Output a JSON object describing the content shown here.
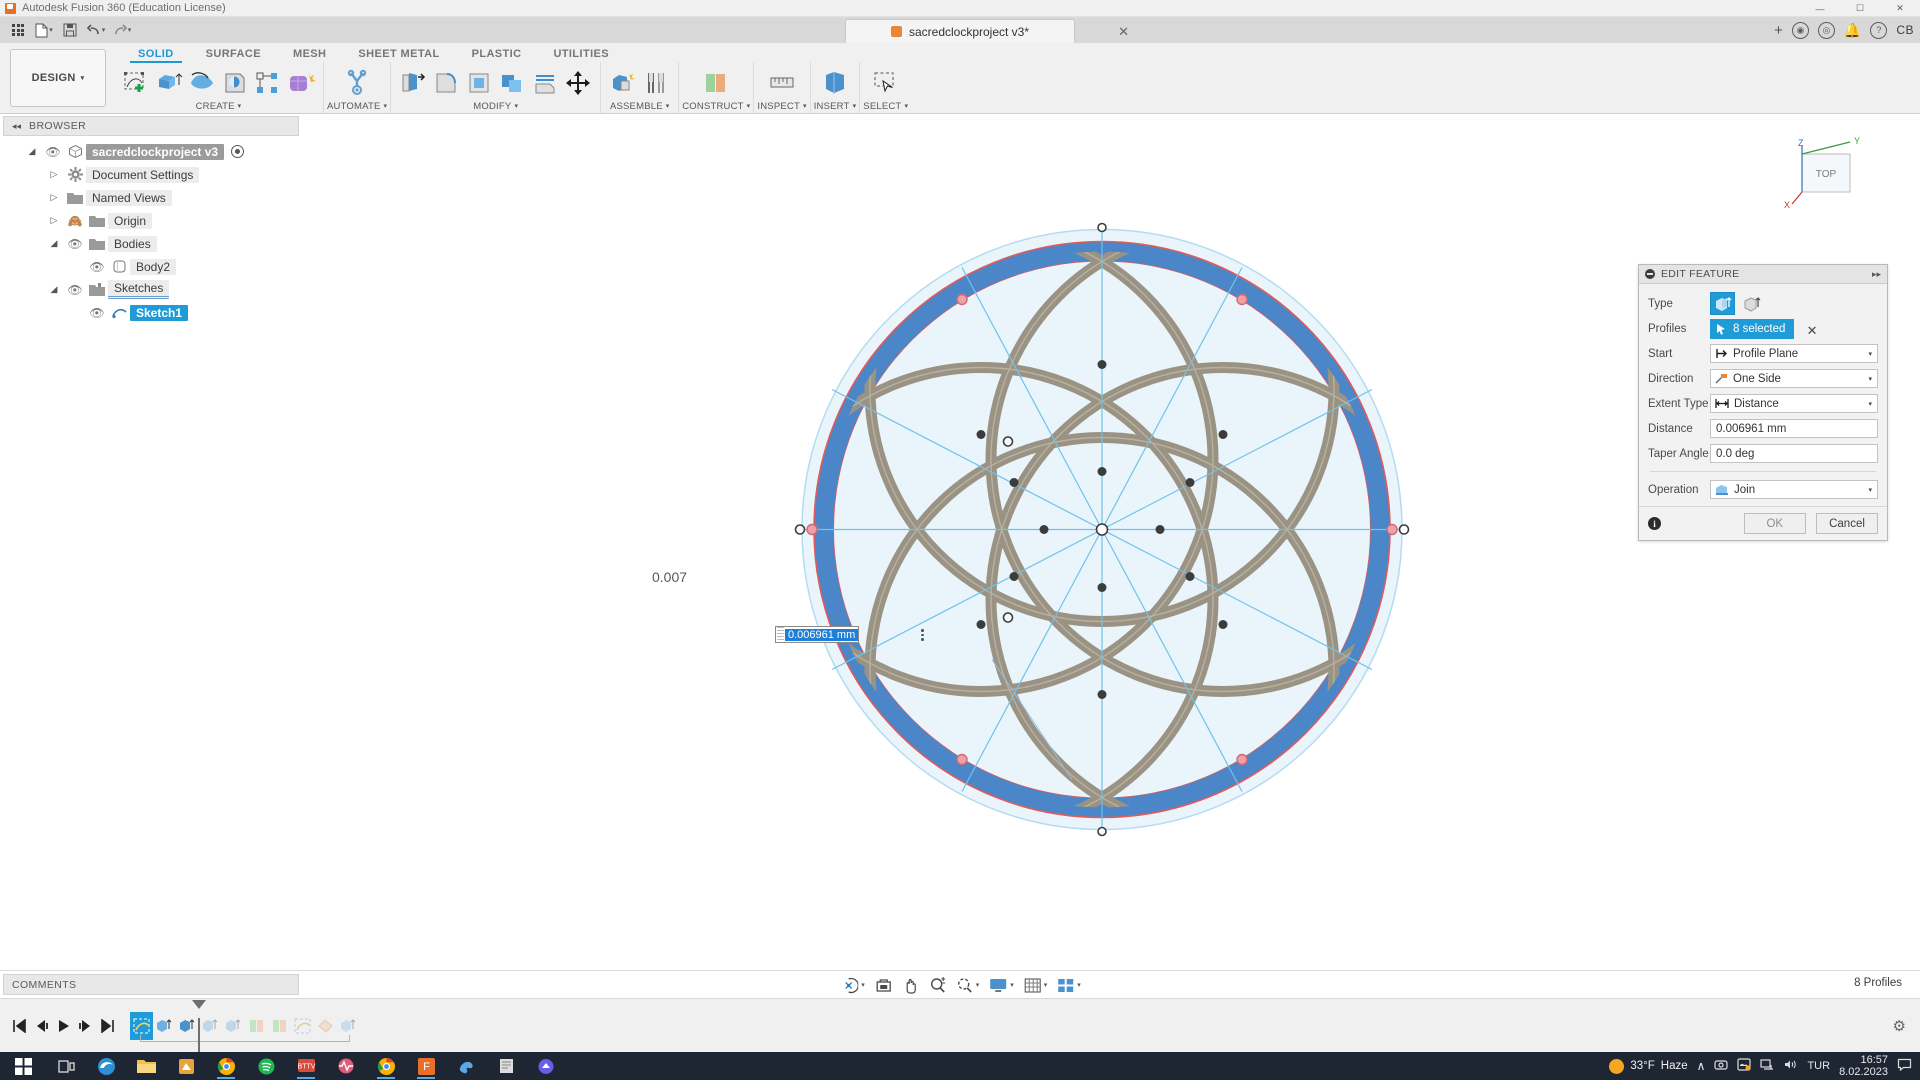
{
  "titlebar": {
    "app_title": "Autodesk Fusion 360 (Education License)",
    "minimize": "—",
    "maximize": "☐",
    "close": "✕"
  },
  "quick_access": {
    "app_grid_icon": "grid-icon",
    "new_file_icon": "new-file-icon",
    "save_icon": "save-icon",
    "undo_icon": "undo-icon",
    "redo_icon": "redo-icon",
    "document_tab": "sacredclockproject v3*",
    "document_tab_close": "✕",
    "add_tab": "+",
    "help_icon": "help-icon",
    "user_initials": "CB"
  },
  "ribbon": {
    "workspace": "DESIGN",
    "workspace_caret": "▾",
    "tabs": [
      {
        "label": "SOLID",
        "active": true
      },
      {
        "label": "SURFACE",
        "active": false
      },
      {
        "label": "MESH",
        "active": false
      },
      {
        "label": "SHEET METAL",
        "active": false
      },
      {
        "label": "PLASTIC",
        "active": false
      },
      {
        "label": "UTILITIES",
        "active": false
      }
    ],
    "panels": [
      {
        "label": "CREATE",
        "caret": "▾"
      },
      {
        "label": "AUTOMATE",
        "caret": "▾"
      },
      {
        "label": "MODIFY",
        "caret": "▾"
      },
      {
        "label": "ASSEMBLE",
        "caret": "▾"
      },
      {
        "label": "CONSTRUCT",
        "caret": "▾"
      },
      {
        "label": "INSPECT",
        "caret": "▾"
      },
      {
        "label": "INSERT",
        "caret": "▾"
      },
      {
        "label": "SELECT",
        "caret": "▾"
      }
    ]
  },
  "browser": {
    "title": "BROWSER",
    "collapse_icon": "◂◂",
    "tree": [
      {
        "label": "sacredclockproject v3",
        "arrow": "◢",
        "eye": "visible",
        "icon": "component-icon",
        "level": 0,
        "style": "root"
      },
      {
        "label": "Document Settings",
        "arrow": "▷",
        "eye": "none",
        "icon": "gear-icon",
        "level": 1,
        "style": "normal"
      },
      {
        "label": "Named Views",
        "arrow": "▷",
        "eye": "none",
        "icon": "folder-icon",
        "level": 1,
        "style": "normal"
      },
      {
        "label": "Origin",
        "arrow": "▷",
        "eye": "hidden",
        "icon": "folder-icon",
        "level": 1,
        "style": "normal"
      },
      {
        "label": "Bodies",
        "arrow": "◢",
        "eye": "visible",
        "icon": "folder-icon",
        "level": 1,
        "style": "normal"
      },
      {
        "label": "Body2",
        "arrow": "",
        "eye": "visible",
        "icon": "body-icon",
        "level": 2,
        "style": "normal"
      },
      {
        "label": "Sketches",
        "arrow": "◢",
        "eye": "visible",
        "icon": "sketch-folder-icon",
        "level": 1,
        "style": "sketches"
      },
      {
        "label": "Sketch1",
        "arrow": "",
        "eye": "visible",
        "icon": "sketch-icon",
        "level": 2,
        "style": "selected"
      }
    ]
  },
  "viewcube": {
    "face_label": "TOP",
    "axis_z": "Z",
    "axis_y": "Y",
    "axis_x": "X"
  },
  "dialog": {
    "title": "EDIT FEATURE",
    "expand_icon": "▸▸",
    "rows": [
      {
        "label": "Type",
        "kind": "type-buttons"
      },
      {
        "label": "Profiles",
        "kind": "selection",
        "value": "8 selected",
        "clear": "✕"
      },
      {
        "label": "Start",
        "kind": "select",
        "value": "Profile Plane",
        "icon": "profile-plane-icon"
      },
      {
        "label": "Direction",
        "kind": "select",
        "value": "One Side",
        "icon": "one-side-icon"
      },
      {
        "label": "Extent Type",
        "kind": "select",
        "value": "Distance",
        "icon": "distance-icon"
      },
      {
        "label": "Distance",
        "kind": "text",
        "value": "0.006961 mm"
      },
      {
        "label": "Taper Angle",
        "kind": "text",
        "value": "0.0 deg"
      },
      {
        "label": "Operation",
        "kind": "select",
        "value": "Join",
        "icon": "join-icon"
      }
    ],
    "ok_label": "OK",
    "cancel_label": "Cancel",
    "info_icon": "i"
  },
  "canvas": {
    "dimension_label": "0.007",
    "value_input": "0.006961 mm",
    "options_icon": "more-options-icon"
  },
  "statusbar": {
    "comments_title": "COMMENTS",
    "profiles_status": "8 Profiles",
    "nav_items": [
      {
        "name": "orbit-icon",
        "caret": "▾"
      },
      {
        "name": "look-at-icon",
        "caret": ""
      },
      {
        "name": "pan-icon",
        "caret": ""
      },
      {
        "name": "zoom-icon",
        "caret": ""
      },
      {
        "name": "fit-icon",
        "caret": "▾"
      },
      {
        "name": "display-settings-icon",
        "caret": "▾"
      },
      {
        "name": "grid-snaps-icon",
        "caret": "▾"
      },
      {
        "name": "viewports-icon",
        "caret": "▾"
      }
    ]
  },
  "timeline": {
    "controls": [
      "go-to-beginning-icon",
      "step-back-icon",
      "play-icon",
      "step-forward-icon",
      "go-to-end-icon"
    ],
    "features": [
      {
        "name": "sketch-feature",
        "active": true
      },
      {
        "name": "extrude-feature-1",
        "active": false
      },
      {
        "name": "extrude-feature-2",
        "active": false
      },
      {
        "name": "extrude-feature-3",
        "active": false
      },
      {
        "name": "extrude-feature-4",
        "active": false
      },
      {
        "name": "surface-feature-1",
        "active": false
      },
      {
        "name": "surface-feature-2",
        "active": false
      },
      {
        "name": "sketch-feature-2",
        "active": false
      },
      {
        "name": "plane-feature",
        "active": false
      },
      {
        "name": "extrude-feature-5",
        "active": false
      }
    ],
    "settings_icon": "gear-icon"
  },
  "taskbar": {
    "start_icon": "windows-start-icon",
    "apps": [
      "task-view-icon",
      "edge-icon",
      "file-explorer-icon",
      "store-icon",
      "chrome-icon",
      "spotify-icon",
      "bttv-icon",
      "health-icon",
      "chrome-2-icon",
      "fusion360-icon",
      "paint-icon",
      "notes-icon",
      "misc-icon"
    ],
    "weather_temp": "33°F",
    "weather_desc": "Haze",
    "tray_chevron": "∧",
    "tray_icons": [
      "camera-icon",
      "onedrive-icon",
      "network-icon",
      "volume-icon"
    ],
    "language": "TUR",
    "clock_time": "16:57",
    "clock_date": "8.02.2023",
    "notification_icon": "notification-icon"
  },
  "colors": {
    "accent_blue": "#1f9bd8",
    "sketch_blue": "#4a86c8",
    "geometry_gray": "#9a9383",
    "canvas_fill": "#eaf4fb",
    "construction_red": "#e05b5b",
    "taskbar": "#1f2633"
  }
}
